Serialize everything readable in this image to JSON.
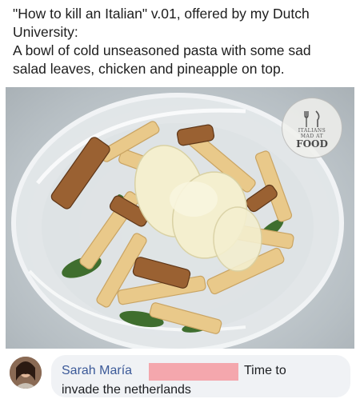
{
  "post": {
    "lines": [
      "\"How to kill an Italian\" v.01, offered by my Dutch",
      "University:",
      "A bowl of cold unseasoned pasta with some sad",
      "salad leaves, chicken and pineapple on top."
    ]
  },
  "photo": {
    "alt": "Bowl of penne pasta with salad leaves, chicken and pineapple",
    "watermark": {
      "top_text": "ITALIANS",
      "small_text": "MAD AT",
      "main_text": "FOOD"
    }
  },
  "comment": {
    "author": "Sarah María",
    "text_part1": "Time to",
    "text_part2": "invade the netherlands",
    "redaction_color": "#f4a7ad"
  }
}
